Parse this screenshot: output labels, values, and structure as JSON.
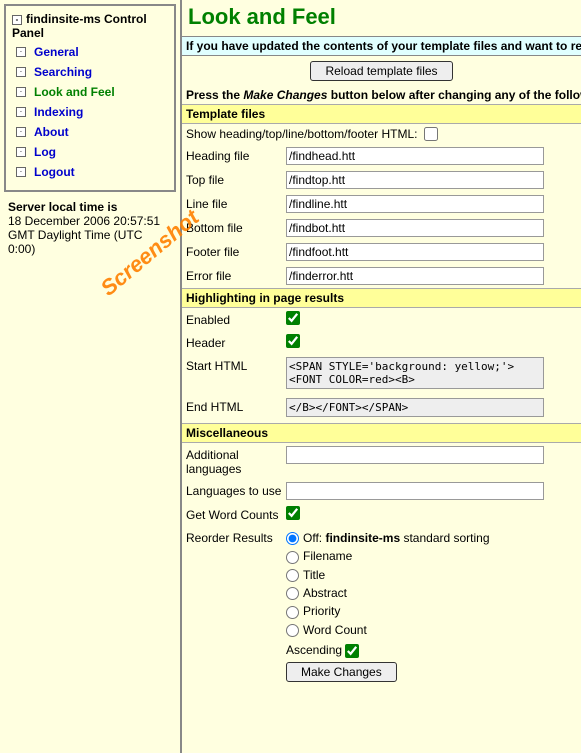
{
  "sidebar": {
    "title_pre": "findinsite-ms",
    "title_post": " Control Panel",
    "items": [
      {
        "label": "General",
        "active": false
      },
      {
        "label": "Searching",
        "active": false
      },
      {
        "label": "Look and Feel",
        "active": true
      },
      {
        "label": "Indexing",
        "active": false
      },
      {
        "label": "About",
        "active": false
      },
      {
        "label": "Log",
        "active": false
      },
      {
        "label": "Logout",
        "active": false
      }
    ]
  },
  "server_time": {
    "prefix": "Server local time is",
    "line1": "18 December 2006 20:57:51",
    "line2": "GMT Daylight Time (UTC 0:00)"
  },
  "page": {
    "title": "Look and Feel",
    "update_msg": "If you have updated the contents of your template files and want to relo",
    "reload_btn": "Reload template files",
    "press_msg_pre": "Press the ",
    "press_msg_btn": "Make Changes",
    "press_msg_post": " button below after changing any of the follow"
  },
  "sections": {
    "templates": {
      "head": "Template files",
      "show_label": "Show heading/top/line/bottom/footer HTML:",
      "show_checked": false,
      "heading_lbl": "Heading file",
      "heading_val": "/findhead.htt",
      "top_lbl": "Top file",
      "top_val": "/findtop.htt",
      "line_lbl": "Line file",
      "line_val": "/findline.htt",
      "bottom_lbl": "Bottom file",
      "bottom_val": "/findbot.htt",
      "footer_lbl": "Footer file",
      "footer_val": "/findfoot.htt",
      "error_lbl": "Error file",
      "error_val": "/finderror.htt"
    },
    "highlight": {
      "head": "Highlighting in page results",
      "enabled_lbl": "Enabled",
      "enabled_checked": true,
      "header_lbl": "Header",
      "header_checked": true,
      "start_lbl": "Start HTML",
      "start_val": "<SPAN STYLE='background: yellow;'><FONT COLOR=red><B>",
      "end_lbl": "End HTML",
      "end_val": "</B></FONT></SPAN>"
    },
    "misc": {
      "head": "Miscellaneous",
      "addlang_lbl": "Additional languages",
      "addlang_val": "",
      "uselang_lbl": "Languages to use",
      "uselang_val": "",
      "wc_lbl": "Get Word Counts",
      "wc_checked": true,
      "reorder_lbl": "Reorder Results",
      "reorder_opts": {
        "off_pre": "Off: ",
        "off_bold": "findinsite-ms",
        "off_post": " standard sorting",
        "filename": "Filename",
        "title": "Title",
        "abstract": "Abstract",
        "priority": "Priority",
        "wordcount": "Word Count"
      },
      "asc_lbl": "Ascending",
      "asc_checked": true,
      "make_changes": "Make Changes"
    }
  },
  "watermark": "Screenshot"
}
